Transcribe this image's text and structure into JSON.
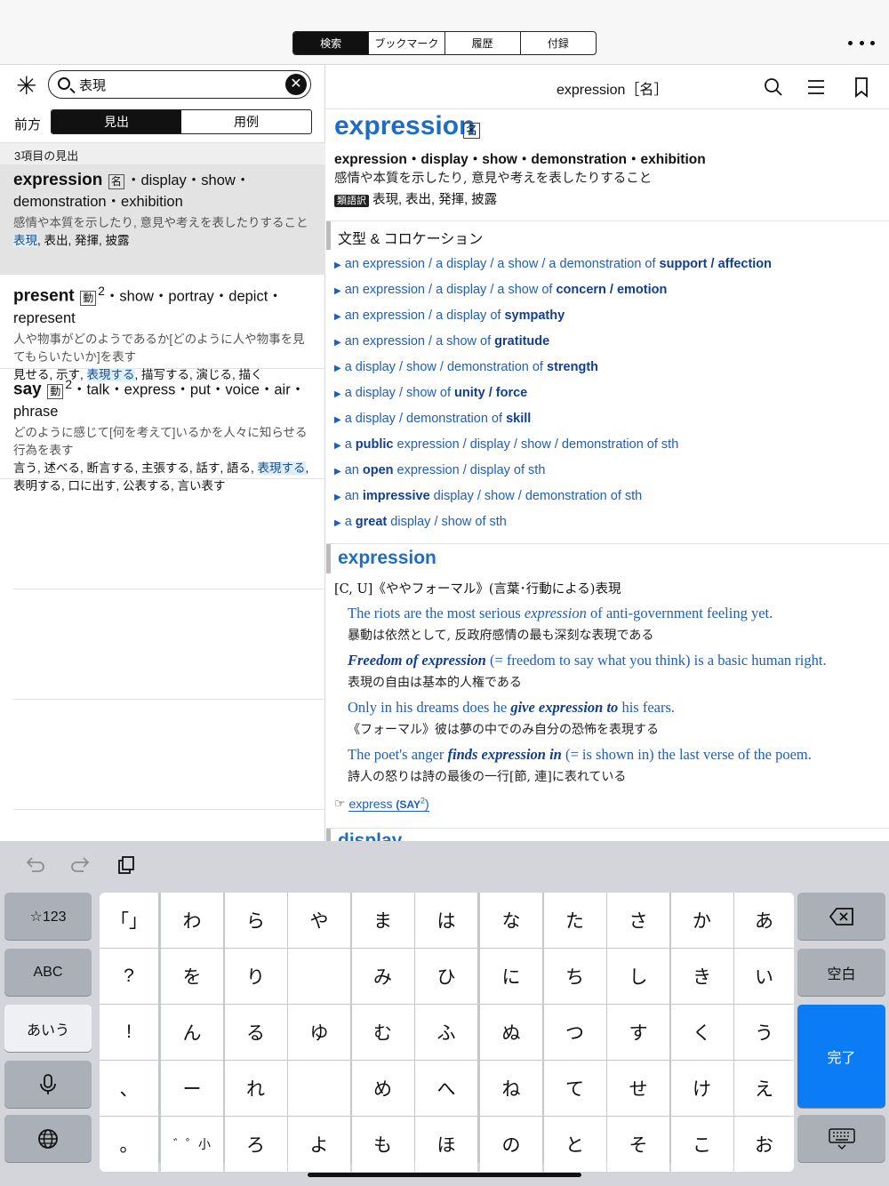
{
  "tabs": [
    "検索",
    "ブックマーク",
    "履歴",
    "付録"
  ],
  "search": {
    "value": "表現",
    "star": "✳"
  },
  "direction_label": "前方",
  "mode_tabs": [
    "見出",
    "用例"
  ],
  "result_count": "3項目の見出",
  "results": [
    {
      "headword": "expression",
      "pos": "名",
      "synonyms": "・display・show・demonstration・exhibition",
      "definition": "感情や本質を示したり, 意見や考えを表したりすること",
      "trans_hl": "表現",
      "trans_rest": ", 表出, 発揮, 披露"
    },
    {
      "headword": "present",
      "pos": "動",
      "sup": "2",
      "synonyms": "・show・portray・depict・represent",
      "definition": "人や物事がどのようであるか[どのように人や物事を見てもらいたいか]を表す",
      "trans_pre": "見せる, 示す, ",
      "trans_hl": "表現する",
      "trans_post": ", 描写する, 演じる, 描く"
    },
    {
      "headword": "say",
      "pos": "動",
      "sup": "2",
      "synonyms": "・talk・express・put・voice・air・phrase",
      "definition": "どのように感じて[何を考えて]いるかを人々に知らせる行為を表す",
      "trans_pre": "言う, 述べる, 断言する, 主張する, 話す, 語る, ",
      "trans_hl": "表現する",
      "trans_post": ", 表明する, 口に出す, 公表する, 言い表す"
    }
  ],
  "entry": {
    "header_title": "expression［名］",
    "headword": "expression",
    "pos": "名",
    "synonyms": "expression・display・show・demonstration・exhibition",
    "definition": "感情や本質を示したり, 意見や考えを表したりすること",
    "syn_tag": "類語訳",
    "syn_trans": "表現, 表出, 発揮, 披露",
    "collocation_title": "文型 & コロケーション",
    "collocations": [
      {
        "plain": "an expression / a display / a show / a demonstration of ",
        "bold": "support / affection"
      },
      {
        "plain": "an expression / a display / a show of ",
        "bold": "concern / emotion"
      },
      {
        "plain": "an expression / a display of ",
        "bold": "sympathy"
      },
      {
        "plain": "an expression / a show of ",
        "bold": "gratitude"
      },
      {
        "plain": "a display / show / demonstration of ",
        "bold": "strength"
      },
      {
        "plain": "a display / show of ",
        "bold": "unity / force"
      },
      {
        "plain": "a display / demonstration of ",
        "bold": "skill"
      },
      {
        "pre": "a ",
        "bold": "public",
        "post": " expression / display / show / demonstration of sth"
      },
      {
        "pre": "an ",
        "bold": "open",
        "post": " expression / display of sth"
      },
      {
        "pre": "an ",
        "bold": "impressive",
        "post": " display / show / demonstration of sth"
      },
      {
        "pre": "a ",
        "bold": "great",
        "post": " display / show of sth"
      }
    ],
    "sense_title": "expression",
    "grammar": "[C, U]《ややフォーマル》(言葉･行動による)表現",
    "examples": [
      {
        "pre": "The riots are the most serious ",
        "it": "expression",
        "post": " of anti-government feeling yet.",
        "jp": "暴動は依然として, 反政府感情の最も深刻な表現である"
      },
      {
        "bold": "Freedom of expression",
        "post": " (= freedom to say what you think) is a basic human right.",
        "jp": "表現の自由は基本的人権である"
      },
      {
        "pre": "Only in his dreams does he ",
        "bold": "give expression to",
        "post": " his fears.",
        "jp": "《フォーマル》彼は夢の中でのみ自分の恐怖を表現する"
      },
      {
        "pre": "The poet's anger ",
        "bold": "finds expression in",
        "post": " (= is shown in) the last verse of the poem.",
        "jp": "詩人の怒りは詩の最後の一行[節, 連]に表れている"
      }
    ],
    "xref_icon": "☞",
    "xref": "express",
    "xref_tag": "(SAY",
    "xref_sup": "2",
    "xref_close": ")",
    "next_section": "display"
  },
  "keyboard": {
    "left_keys": [
      "☆123",
      "ABC",
      "あいう"
    ],
    "right_keys": [
      "空白",
      "完了"
    ],
    "grid": [
      [
        "「」",
        "わ",
        "ら",
        "や",
        "ま",
        "は",
        "な",
        "た",
        "さ",
        "か",
        "あ"
      ],
      [
        "?",
        "を",
        "り",
        "",
        "み",
        "ひ",
        "に",
        "ち",
        "し",
        "き",
        "い"
      ],
      [
        "!",
        "ん",
        "る",
        "ゆ",
        "む",
        "ふ",
        "ぬ",
        "つ",
        "す",
        "く",
        "う"
      ],
      [
        "、",
        "ー",
        "れ",
        "",
        "め",
        "へ",
        "ね",
        "て",
        "せ",
        "け",
        "え"
      ],
      [
        "。",
        "゛゜小",
        "ろ",
        "よ",
        "も",
        "ほ",
        "の",
        "と",
        "そ",
        "こ",
        "お"
      ]
    ]
  },
  "icons": {
    "search": "search-icon",
    "menu": "menu-icon",
    "bookmark": "bookmark-icon",
    "undo": "undo-icon",
    "redo": "redo-icon",
    "paste": "paste-icon",
    "mic": "microphone-icon",
    "globe": "globe-icon",
    "backspace": "backspace-icon",
    "hide_keyboard": "keyboard-hide-icon"
  },
  "colors": {
    "accent": "#1f6cc6",
    "link": "#1f5fb5",
    "done_key": "#0b7cf5"
  }
}
